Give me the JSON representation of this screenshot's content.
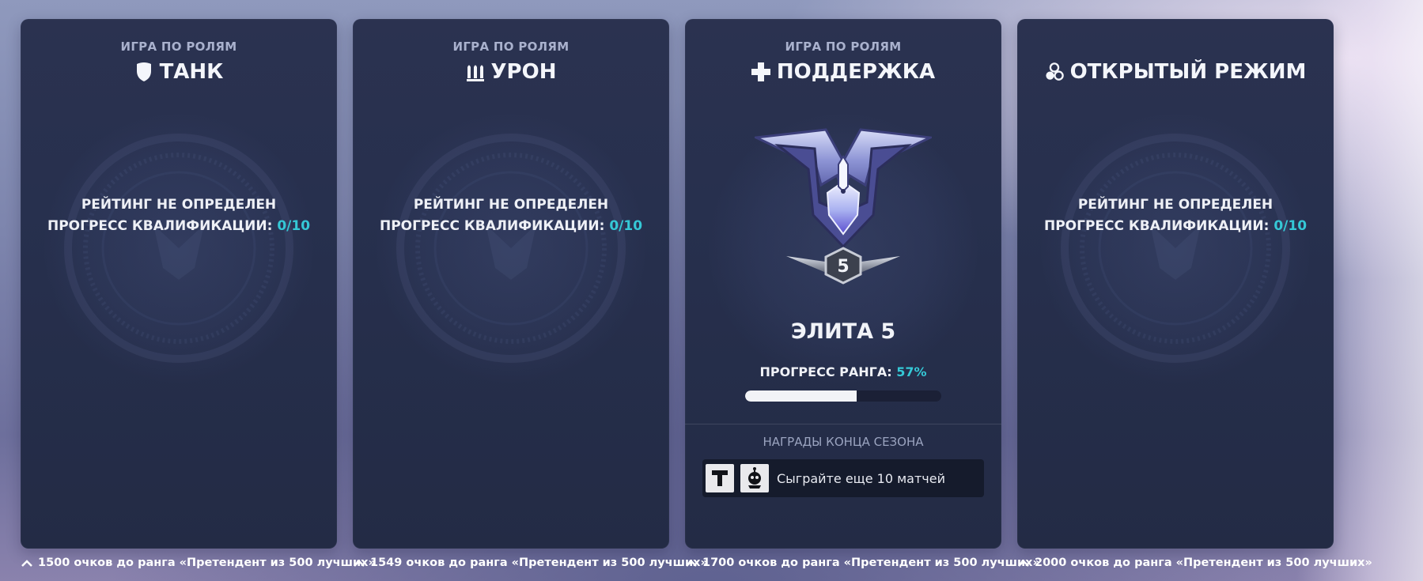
{
  "colors": {
    "accent_teal": "#35c8d6",
    "panel_bg": "#27304e",
    "progress_fill": "#f2f3f7"
  },
  "panels": [
    {
      "id": "tank",
      "mode_label": "ИГРА ПО РОЛЯМ",
      "role_icon": "tank-shield-icon",
      "role_title": "ТАНК",
      "status_line": "РЕЙТИНГ НЕ ОПРЕДЕЛЕН",
      "qual_label": "ПРОГРЕСС КВАЛИФИКАЦИИ:",
      "qual_value": "0/10"
    },
    {
      "id": "damage",
      "mode_label": "ИГРА ПО РОЛЯМ",
      "role_icon": "damage-bullets-icon",
      "role_title": "УРОН",
      "status_line": "РЕЙТИНГ НЕ ОПРЕДЕЛЕН",
      "qual_label": "ПРОГРЕСС КВАЛИФИКАЦИИ:",
      "qual_value": "0/10"
    },
    {
      "id": "support",
      "mode_label": "ИГРА ПО РОЛЯМ",
      "role_icon": "support-cross-icon",
      "role_title": "ПОДДЕРЖКА",
      "rank_icon": "elite-rank-badge-icon",
      "rank_tier": "5",
      "rank_name": "ЭЛИТА 5",
      "rank_progress_label": "ПРОГРЕСС РАНГА:",
      "rank_progress_value": "57%",
      "rank_progress_fraction": 0.57,
      "rewards_label": "НАГРАДЫ КОНЦА СЕЗОНА",
      "reward_icons": [
        "title-t-icon",
        "player-icon-skull-icon"
      ],
      "reward_text": "Сыграйте еще 10 матчей"
    },
    {
      "id": "open",
      "mode_label": "",
      "role_icon": "open-queue-icon",
      "role_title": "ОТКРЫТЫЙ РЕЖИМ",
      "status_line": "РЕЙТИНГ НЕ ОПРЕДЕЛЕН",
      "qual_label": "ПРОГРЕСС КВАЛИФИКАЦИИ:",
      "qual_value": "0/10"
    }
  ],
  "footers": [
    {
      "text": "1500 очков до ранга «Претендент из 500 лучших»"
    },
    {
      "text": "1549 очков до ранга «Претендент из 500 лучших»"
    },
    {
      "text": "1700 очков до ранга «Претендент из 500 лучших»"
    },
    {
      "text": "2000 очков до ранга «Претендент из 500 лучших»"
    }
  ]
}
